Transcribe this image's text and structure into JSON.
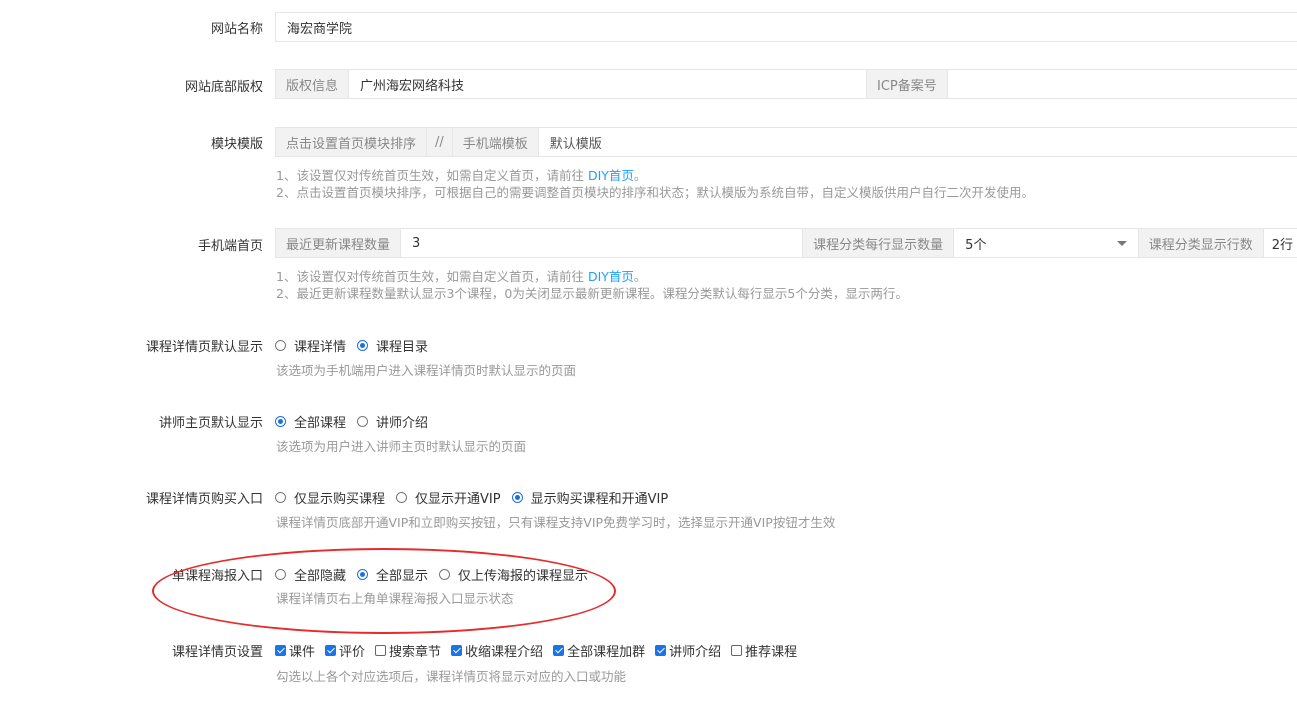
{
  "site_name": {
    "label": "网站名称",
    "value": "海宏商学院"
  },
  "footer_copyright": {
    "label": "网站底部版权",
    "copyright_addon": "版权信息",
    "copyright_value": "广州海宏网络科技",
    "icp_addon": "ICP备案号",
    "icp_value": ""
  },
  "module_template": {
    "label": "模块模版",
    "sort_link": "点击设置首页模块排序",
    "separator": "//",
    "mobile_addon": "手机端模板",
    "mobile_value": "默认模版",
    "help1_prefix": "1、该设置仅对传统首页生效，如需自定义首页，请前往 ",
    "help1_link": "DIY首页",
    "help1_suffix": "。",
    "help2": "2、点击设置首页模块排序，可根据自己的需要调整首页模块的排序和状态；默认模版为系统自带，自定义模版供用户自行二次开发使用。"
  },
  "mobile_home": {
    "label": "手机端首页",
    "recent_addon": "最近更新课程数量",
    "recent_value": "3",
    "per_row_addon": "课程分类每行显示数量",
    "per_row_value": "5个",
    "rows_addon": "课程分类显示行数",
    "rows_value": "2行",
    "help1_prefix": "1、该设置仅对传统首页生效，如需自定义首页，请前往 ",
    "help1_link": "DIY首页",
    "help1_suffix": "。",
    "help2": "2、最近更新课程数量默认显示3个课程，0为关闭显示最新更新课程。课程分类默认每行显示5个分类，显示两行。"
  },
  "course_detail_default": {
    "label": "课程详情页默认显示",
    "options": [
      "课程详情",
      "课程目录"
    ],
    "selected": 1,
    "help": "该选项为手机端用户进入课程详情页时默认显示的页面"
  },
  "teacher_home_default": {
    "label": "讲师主页默认显示",
    "options": [
      "全部课程",
      "讲师介绍"
    ],
    "selected": 0,
    "help": "该选项为用户进入讲师主页时默认显示的页面"
  },
  "course_purchase_entry": {
    "label": "课程详情页购买入口",
    "options": [
      "仅显示购买课程",
      "仅显示开通VIP",
      "显示购买课程和开通VIP"
    ],
    "selected": 2,
    "help": "课程详情页底部开通VIP和立即购买按钮，只有课程支持VIP免费学习时，选择显示开通VIP按钮才生效"
  },
  "poster_entry": {
    "label": "单课程海报入口",
    "options": [
      "全部隐藏",
      "全部显示",
      "仅上传海报的课程显示"
    ],
    "selected": 1,
    "help": "课程详情页右上角单课程海报入口显示状态"
  },
  "course_detail_settings": {
    "label": "课程详情页设置",
    "options": [
      {
        "label": "课件",
        "checked": true
      },
      {
        "label": "评价",
        "checked": true
      },
      {
        "label": "搜索章节",
        "checked": false
      },
      {
        "label": "收缩课程介绍",
        "checked": true
      },
      {
        "label": "全部课程加群",
        "checked": true
      },
      {
        "label": "讲师介绍",
        "checked": true
      },
      {
        "label": "推荐课程",
        "checked": false
      }
    ],
    "help": "勾选以上各个对应选项后，课程详情页将显示对应的入口或功能"
  },
  "colors": {
    "accent": "#1e6fd9",
    "link": "#1e9fff",
    "highlight": "#e52b2b"
  }
}
